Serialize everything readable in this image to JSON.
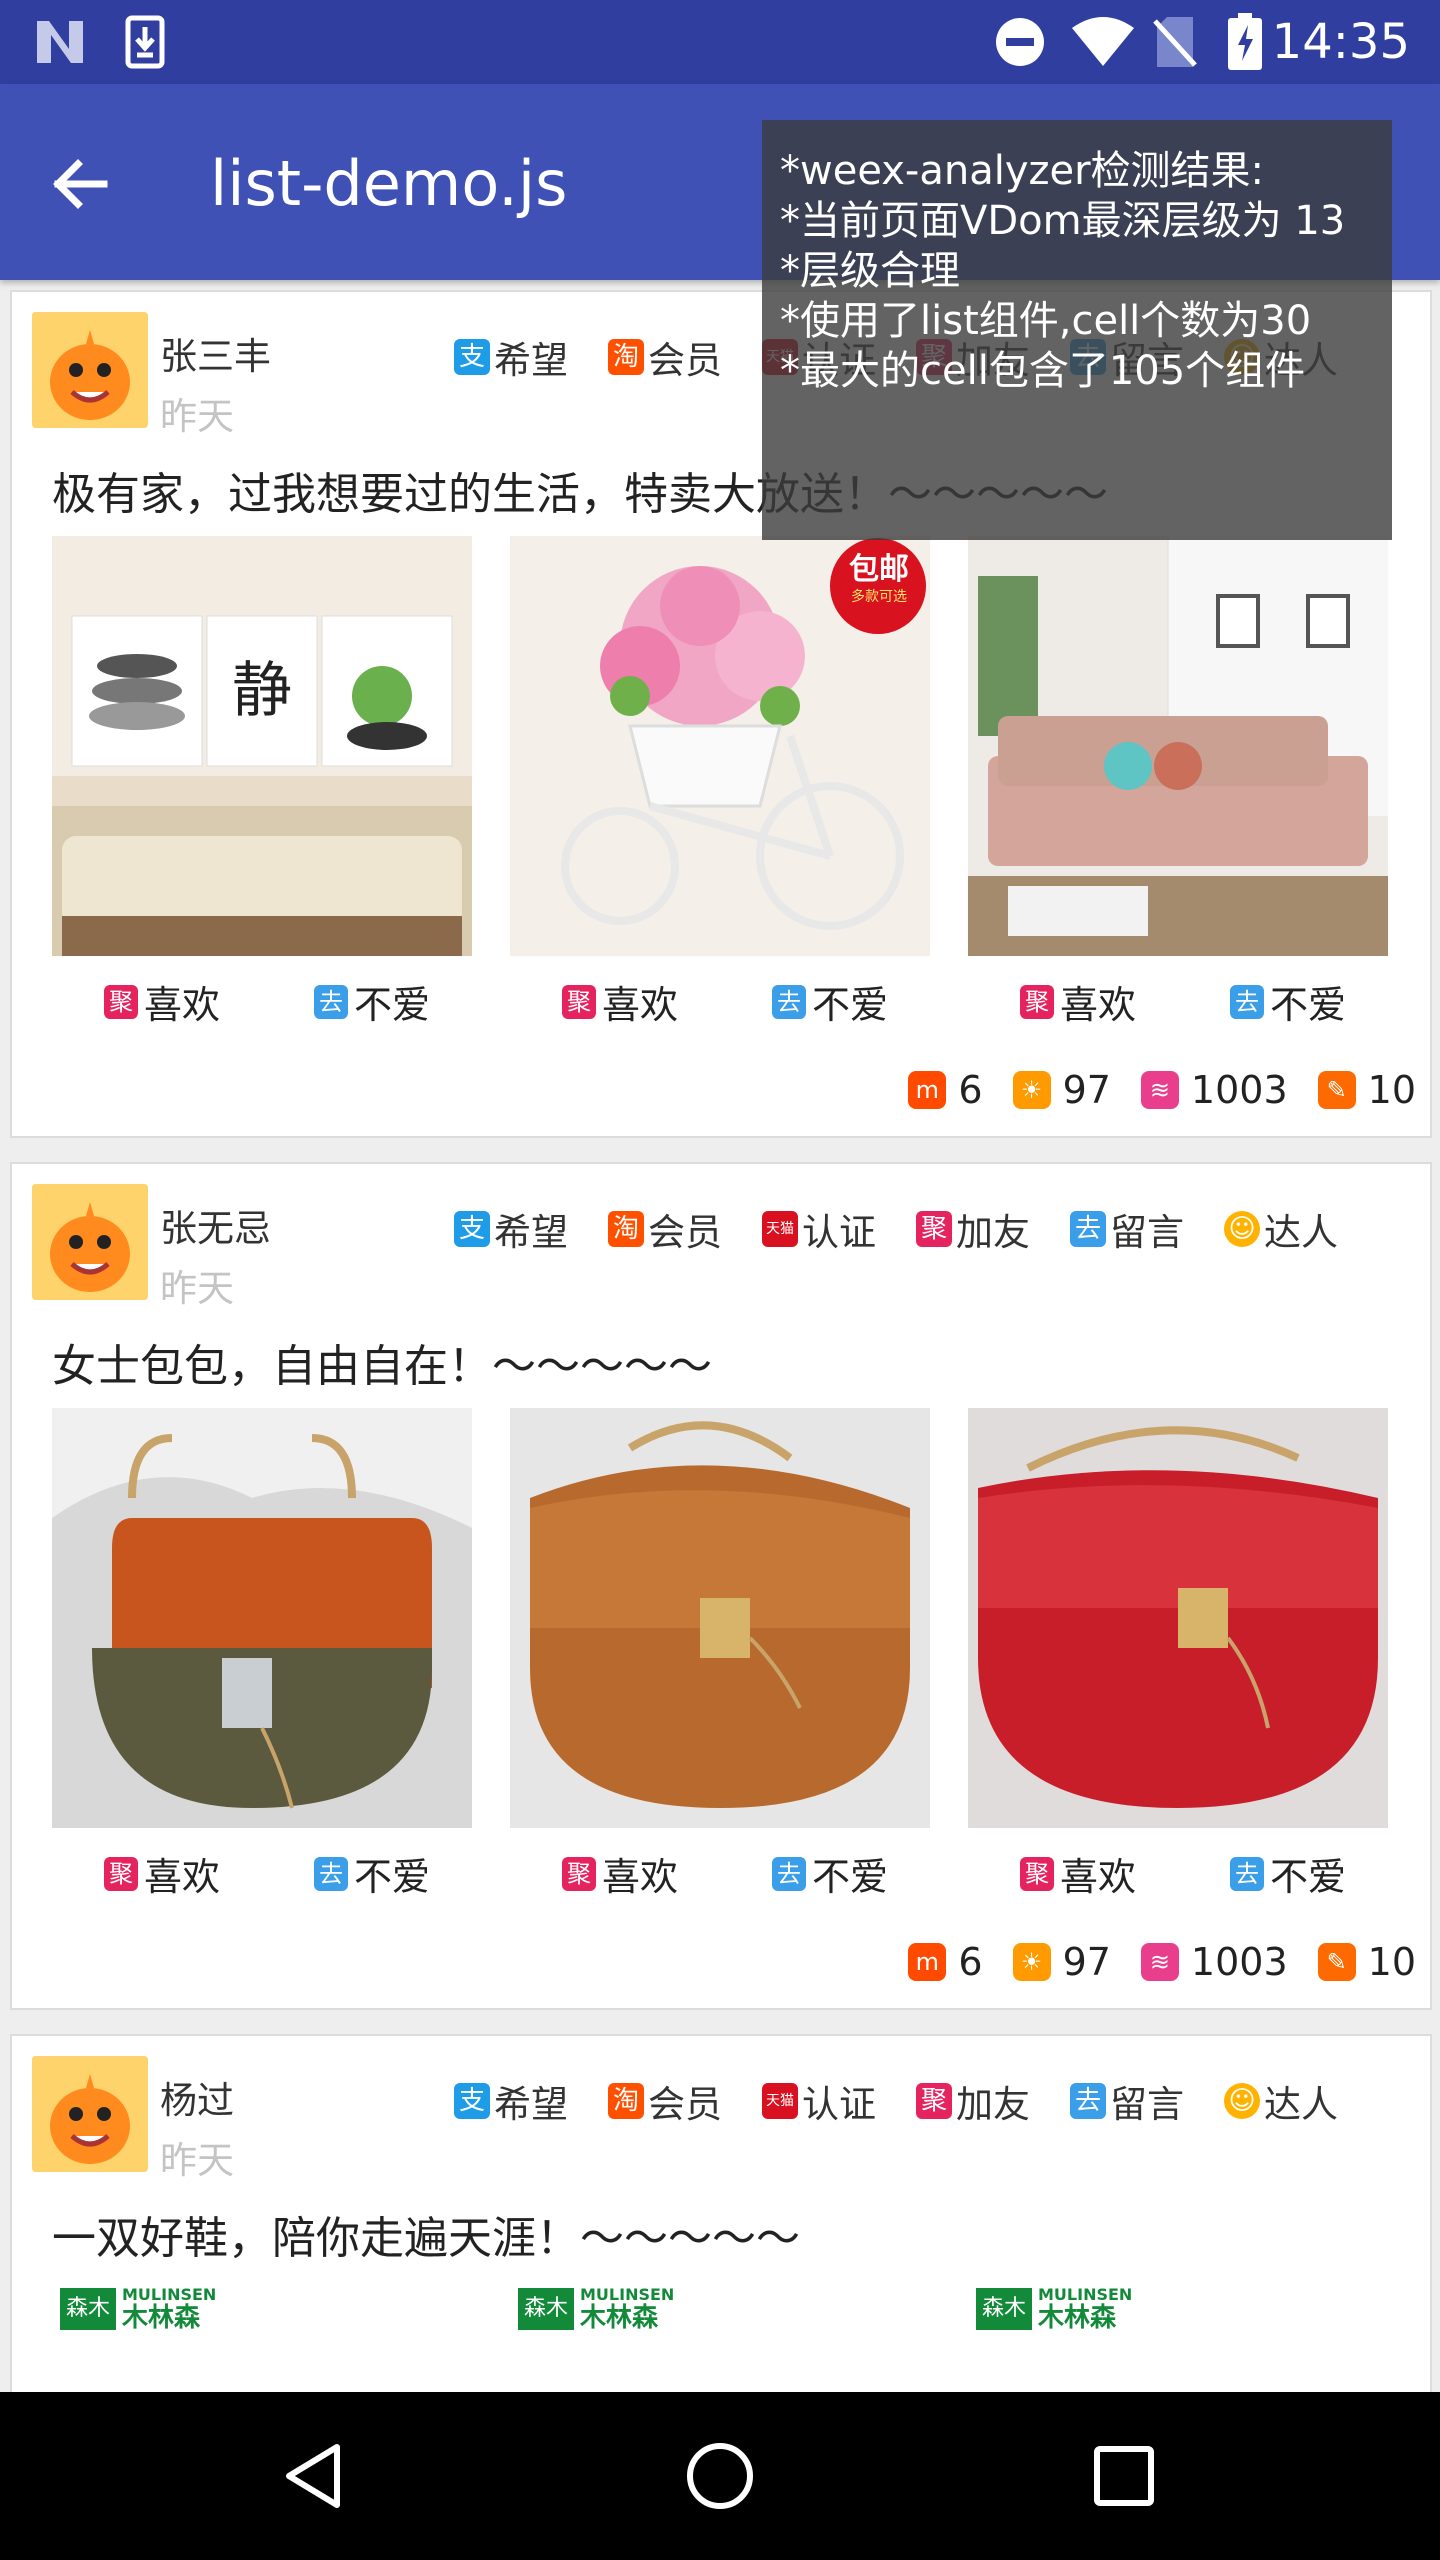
{
  "status_bar": {
    "time": "14:35",
    "left_icons": [
      "n-logo-icon",
      "download-icon"
    ],
    "right_icons": [
      "do-not-disturb-icon",
      "wifi-icon",
      "no-sim-icon",
      "battery-charging-icon"
    ]
  },
  "app_bar": {
    "title": "list-demo.js",
    "back_icon": "back-arrow-icon"
  },
  "colors": {
    "status_bar": "#303f9f",
    "app_bar": "#3f51b5",
    "divider": "#dcdcdc",
    "date_text": "#c4c4c4"
  },
  "analyzer": {
    "lines": [
      "*weex-analyzer检测结果:",
      "*当前页面VDom最深层级为 13",
      "*层级合理",
      "*使用了list组件,cell个数为30",
      "*最大的cell包含了105个组件"
    ]
  },
  "posts": [
    {
      "name": "张三丰",
      "date": "昨天",
      "tags": [
        {
          "icon": "支",
          "label": "希望"
        },
        {
          "icon": "淘",
          "label": "会员"
        },
        {
          "icon": "天猫",
          "label": "认证"
        },
        {
          "icon": "聚",
          "label": "加友"
        },
        {
          "icon": "去",
          "label": "留言"
        },
        {
          "icon": "☺",
          "label": "达人"
        }
      ],
      "text": "极有家，过我想要过的生活，特卖大放送！～～～～～",
      "actions": [
        {
          "like": "喜欢",
          "dislike": "不爱",
          "like_icon": "聚",
          "dislike_icon": "去"
        },
        {
          "like": "喜欢",
          "dislike": "不爱",
          "like_icon": "聚",
          "dislike_icon": "去"
        },
        {
          "like": "喜欢",
          "dislike": "不爱",
          "like_icon": "聚",
          "dislike_icon": "去"
        }
      ],
      "badge": {
        "title": "包邮",
        "sub": "多款可选"
      },
      "stats": [
        "6",
        "97",
        "1003",
        "10"
      ]
    },
    {
      "name": "张无忌",
      "date": "昨天",
      "tags": [
        {
          "icon": "支",
          "label": "希望"
        },
        {
          "icon": "淘",
          "label": "会员"
        },
        {
          "icon": "天猫",
          "label": "认证"
        },
        {
          "icon": "聚",
          "label": "加友"
        },
        {
          "icon": "去",
          "label": "留言"
        },
        {
          "icon": "☺",
          "label": "达人"
        }
      ],
      "text": "女士包包，自由自在！～～～～～",
      "actions": [
        {
          "like": "喜欢",
          "dislike": "不爱",
          "like_icon": "聚",
          "dislike_icon": "去"
        },
        {
          "like": "喜欢",
          "dislike": "不爱",
          "like_icon": "聚",
          "dislike_icon": "去"
        },
        {
          "like": "喜欢",
          "dislike": "不爱",
          "like_icon": "聚",
          "dislike_icon": "去"
        }
      ],
      "stats": [
        "6",
        "97",
        "1003",
        "10"
      ]
    },
    {
      "name": "杨过",
      "date": "昨天",
      "tags": [
        {
          "icon": "支",
          "label": "希望"
        },
        {
          "icon": "淘",
          "label": "会员"
        },
        {
          "icon": "天猫",
          "label": "认证"
        },
        {
          "icon": "聚",
          "label": "加友"
        },
        {
          "icon": "去",
          "label": "留言"
        },
        {
          "icon": "☺",
          "label": "达人"
        }
      ],
      "text": "一双好鞋，陪你走遍天涯！～～～～～",
      "logos": [
        {
          "en": "MULINSEN",
          "cn": "木林森",
          "mark": "森木"
        },
        {
          "en": "MULINSEN",
          "cn": "木林森",
          "mark": "森木"
        },
        {
          "en": "MULINSEN",
          "cn": "木林森",
          "mark": "森木"
        }
      ]
    }
  ],
  "stat_icons": [
    "m-icon",
    "flame-icon",
    "wave-icon",
    "fire-icon"
  ],
  "nav_bar": {
    "back": "nav-back-icon",
    "home": "nav-home-icon",
    "recents": "nav-recents-icon"
  }
}
